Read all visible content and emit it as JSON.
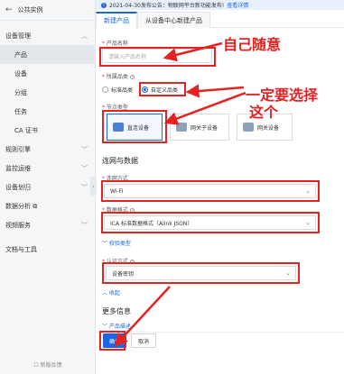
{
  "sidebar": {
    "back_label": "公共实例",
    "items": [
      {
        "label": "设备管理",
        "expanded": true
      },
      {
        "label": "规则引擎"
      },
      {
        "label": "监控运维"
      },
      {
        "label": "设备划归"
      },
      {
        "label": "数据分析 ⧉"
      },
      {
        "label": "视频服务"
      },
      {
        "label": "文档与工具"
      }
    ],
    "sub_items": [
      "产品",
      "设备",
      "分组",
      "任务",
      "CA 证书"
    ],
    "bottom_label": "新版反馈"
  },
  "notice": {
    "text": "2021-04-30发布公告：物联网平台新功能发布!",
    "link": "查看详情"
  },
  "tabs": [
    "新建产品",
    "从设备中心新建产品"
  ],
  "form": {
    "product_name_label": "产品名称",
    "product_name_placeholder": "请输入产品名称",
    "category_label": "所属品类",
    "category_options": [
      "标准品类",
      "自定义品类"
    ],
    "node_type_label": "节点类型",
    "node_types": [
      "直连设备",
      "网关子设备",
      "网关设备"
    ],
    "section_network": "连网与数据",
    "network_label": "连网方式",
    "network_value": "Wi-Fi",
    "data_format_label": "数据格式",
    "data_format_value": "ICA 标准数据格式（Alink JSON）",
    "verify_toggle": "校验类型",
    "auth_label": "认证方式",
    "auth_value": "设备密钥",
    "collapse_toggle": "收起",
    "section_more": "更多信息",
    "product_desc_toggle": "产品描述"
  },
  "buttons": {
    "confirm": "确认",
    "cancel": "取消"
  },
  "annotations": {
    "anno1": "自己随意",
    "anno2_line1": "一定要选择",
    "anno2_line2": "这个"
  },
  "colors": {
    "accent": "#1a66e0",
    "annotation": "#e52222"
  }
}
